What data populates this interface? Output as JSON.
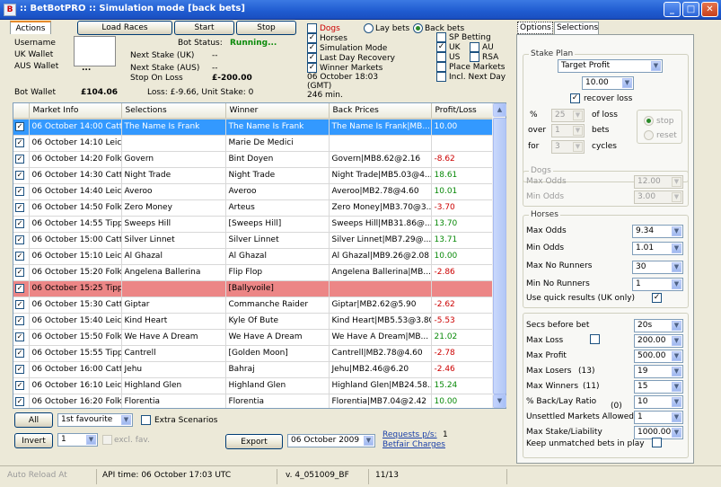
{
  "window": {
    "title": ":: BetBotPRO ::  Simulation mode [back bets]"
  },
  "tabs_left": {
    "actions": "Actions"
  },
  "top_buttons": {
    "load_races": "Load Races",
    "start": "Start",
    "stop": "Stop"
  },
  "account": {
    "username_label": "Username",
    "uk_wallet_label": "UK Wallet",
    "aus_wallet_label": "AUS Wallet",
    "ellipsis": "...",
    "bot_wallet_label": "Bot Wallet",
    "bot_wallet_value": "£104.06",
    "loss_text": "Loss: £-9.66, Unit Stake: 0"
  },
  "status": {
    "bot_status_label": "Bot Status:",
    "bot_status_value": "Running...",
    "next_stake_uk_label": "Next Stake (UK)",
    "next_stake_uk_value": "--",
    "next_stake_aus_label": "Next Stake (AUS)",
    "next_stake_aus_value": "--",
    "stop_on_loss_label": "Stop On Loss",
    "stop_on_loss_value": "£-200.00"
  },
  "filters": {
    "dogs": "Dogs",
    "horses": "Horses",
    "simulation": "Simulation Mode",
    "last_day": "Last Day Recovery",
    "winner_markets": "Winner Markets",
    "date_line1": "06 October 18:03",
    "date_line2": "(GMT)",
    "minutes": "246 min.",
    "lay_bets": "Lay bets",
    "back_bets": "Back bets",
    "sp_betting": "SP Betting",
    "uk": "UK",
    "au": "AU",
    "us": "US",
    "rsa": "RSA",
    "place_markets": "Place Markets",
    "incl_next_day": "Incl. Next Day"
  },
  "grid": {
    "headers": [
      "Market Info",
      "Selections",
      "Winner",
      "Back Prices",
      "Profit/Loss"
    ],
    "rows": [
      {
        "market": "06 October 14:00  Catt",
        "selection": "The Name Is Frank",
        "winner": "The Name Is Frank",
        "back": "The Name Is Frank|MB...",
        "pl": "10.00",
        "style": "selected"
      },
      {
        "market": "06 October 14:10  Leic",
        "selection": "",
        "winner": "Marie De Medici",
        "back": "",
        "pl": "",
        "style": ""
      },
      {
        "market": "06 October 14:20  Folk",
        "selection": "Govern",
        "winner": "Bint Doyen",
        "back": "Govern|MB8.62@2.16",
        "pl": "-8.62",
        "style": "neg"
      },
      {
        "market": "06 October 14:30  Catt",
        "selection": "Night Trade",
        "winner": "Night Trade",
        "back": "Night Trade|MB5.03@4...",
        "pl": "18.61",
        "style": "pos"
      },
      {
        "market": "06 October 14:40  Leic",
        "selection": "Averoo",
        "winner": "Averoo",
        "back": "Averoo|MB2.78@4.60",
        "pl": "10.01",
        "style": "pos"
      },
      {
        "market": "06 October 14:50  Folk",
        "selection": "Zero Money",
        "winner": "Arteus",
        "back": "Zero Money|MB3.70@3...",
        "pl": "-3.70",
        "style": "neg"
      },
      {
        "market": "06 October 14:55  Tipp",
        "selection": "Sweeps Hill",
        "winner": "[Sweeps Hill]",
        "back": "Sweeps Hill|MB31.86@...",
        "pl": "13.70",
        "style": "pos"
      },
      {
        "market": "06 October 15:00  Catt",
        "selection": "Silver Linnet",
        "winner": "Silver Linnet",
        "back": "Silver Linnet|MB7.29@...",
        "pl": "13.71",
        "style": "pos"
      },
      {
        "market": "06 October 15:10  Leic",
        "selection": "Al Ghazal",
        "winner": "Al Ghazal",
        "back": "Al Ghazal|MB9.26@2.08",
        "pl": "10.00",
        "style": "pos"
      },
      {
        "market": "06 October 15:20  Folk",
        "selection": "Angelena Ballerina",
        "winner": "Flip Flop",
        "back": "Angelena Ballerina|MB...",
        "pl": "-2.86",
        "style": "neg"
      },
      {
        "market": "06 October 15:25  Tipp",
        "selection": "",
        "winner": "[Ballyvoile]",
        "back": "",
        "pl": "",
        "style": "red"
      },
      {
        "market": "06 October 15:30  Catt",
        "selection": "Giptar",
        "winner": "Commanche Raider",
        "back": "Giptar|MB2.62@5.90",
        "pl": "-2.62",
        "style": "neg"
      },
      {
        "market": "06 October 15:40  Leic",
        "selection": "Kind Heart",
        "winner": "Kyle Of Bute",
        "back": "Kind Heart|MB5.53@3.80",
        "pl": "-5.53",
        "style": "neg"
      },
      {
        "market": "06 October 15:50  Folk",
        "selection": "We Have A Dream",
        "winner": "We Have A Dream",
        "back": "We Have A Dream|MB...",
        "pl": "21.02",
        "style": "pos"
      },
      {
        "market": "06 October 15:55  Tipp",
        "selection": "Cantrell",
        "winner": "[Golden Moon]",
        "back": "Cantrell|MB2.78@4.60",
        "pl": "-2.78",
        "style": "neg"
      },
      {
        "market": "06 October 16:00  Catt",
        "selection": "Jehu",
        "winner": "Bahraj",
        "back": "Jehu|MB2.46@6.20",
        "pl": "-2.46",
        "style": "neg"
      },
      {
        "market": "06 October 16:10  Leic",
        "selection": "Highland Glen",
        "winner": "Highland Glen",
        "back": "Highland Glen|MB24.58...",
        "pl": "15.24",
        "style": "pos"
      },
      {
        "market": "06 October 16:20  Folk",
        "selection": "Florentia",
        "winner": "Florentia",
        "back": "Florentia|MB7.04@2.42",
        "pl": "10.00",
        "style": "pos"
      }
    ]
  },
  "bottom": {
    "all_button": "All",
    "invert_button": "Invert",
    "fav_select": "1st favourite",
    "extra_scenarios": "Extra Scenarios",
    "num_select": "1",
    "excl_fav": "excl. fav.",
    "export_button": "Export",
    "date_select": "06 October 2009",
    "requests_label": "Requests p/s:",
    "requests_value": "1",
    "betfair_charges": "Betfair Charges"
  },
  "statusbar": {
    "auto_reload": "Auto Reload At",
    "api_time": "API time: 06 October 17:03 UTC",
    "version": "v. 4_051009_BF",
    "count": "11/13"
  },
  "right": {
    "tab_options": "Options",
    "tab_selections": "Selections",
    "stake_plan_title": "Stake Plan",
    "stake_plan_value": "Target Profit",
    "target_value": "10.00",
    "recover_loss": "recover loss",
    "pct": "%",
    "pct_value": "25",
    "of_loss": "of loss",
    "over": "over",
    "over_value": "1",
    "bets": "bets",
    "for": "for",
    "for_value": "3",
    "cycles": "cycles",
    "stop": "stop",
    "reset": "reset",
    "dogs_title": "Dogs",
    "dogs_max_odds": "Max Odds",
    "dogs_max_odds_value": "12.00",
    "dogs_min_odds": "Min Odds",
    "dogs_min_odds_value": "3.00",
    "horses_title": "Horses",
    "max_odds": "Max Odds",
    "max_odds_value": "9.34",
    "min_odds": "Min Odds",
    "min_odds_value": "1.01",
    "max_runners": "Max No Runners",
    "max_runners_value": "30",
    "min_runners": "Min No Runners",
    "min_runners_value": "1",
    "quick_results": "Use quick results (UK only)",
    "secs_before": "Secs before bet",
    "secs_before_value": "20s",
    "max_loss": "Max Loss",
    "max_loss_value": "200.00",
    "max_profit": "Max Profit",
    "max_profit_value": "500.00",
    "max_losers": "Max Losers",
    "max_losers_count": "(13)",
    "max_losers_value": "19",
    "max_winners": "Max Winners",
    "max_winners_count": "(11)",
    "max_winners_value": "15",
    "ratio": "% Back/Lay Ratio",
    "ratio_count": "(0)",
    "ratio_value": "10",
    "unsettled": "Unsettled Markets Allowed",
    "unsettled_value": "1",
    "max_stake": "Max Stake/Liability",
    "max_stake_value": "1000.00",
    "keep_unmatched": "Keep unmatched bets in play"
  }
}
